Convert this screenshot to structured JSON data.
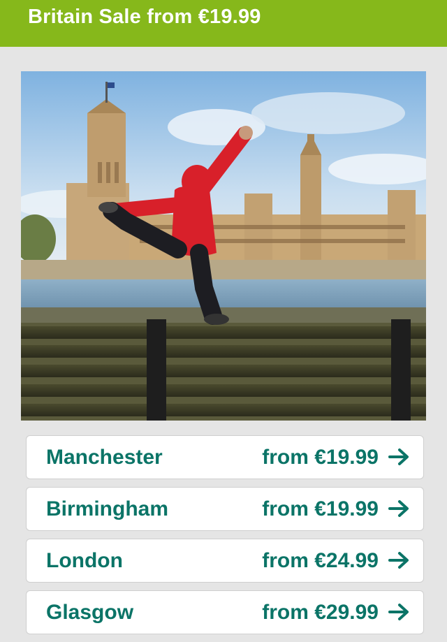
{
  "header": {
    "title": "Britain Sale from €19.99"
  },
  "hero": {
    "icon": "houses-of-parliament-jumping-person-photo"
  },
  "destinations": [
    {
      "name": "Manchester",
      "price": "from €19.99",
      "icon": "arrow-right-icon"
    },
    {
      "name": "Birmingham",
      "price": "from €19.99",
      "icon": "arrow-right-icon"
    },
    {
      "name": "London",
      "price": "from €24.99",
      "icon": "arrow-right-icon"
    },
    {
      "name": "Glasgow",
      "price": "from €29.99",
      "icon": "arrow-right-icon"
    }
  ],
  "colors": {
    "header_bg": "#86b81b",
    "accent_text": "#0b7467",
    "page_bg": "#e5e5e5"
  }
}
